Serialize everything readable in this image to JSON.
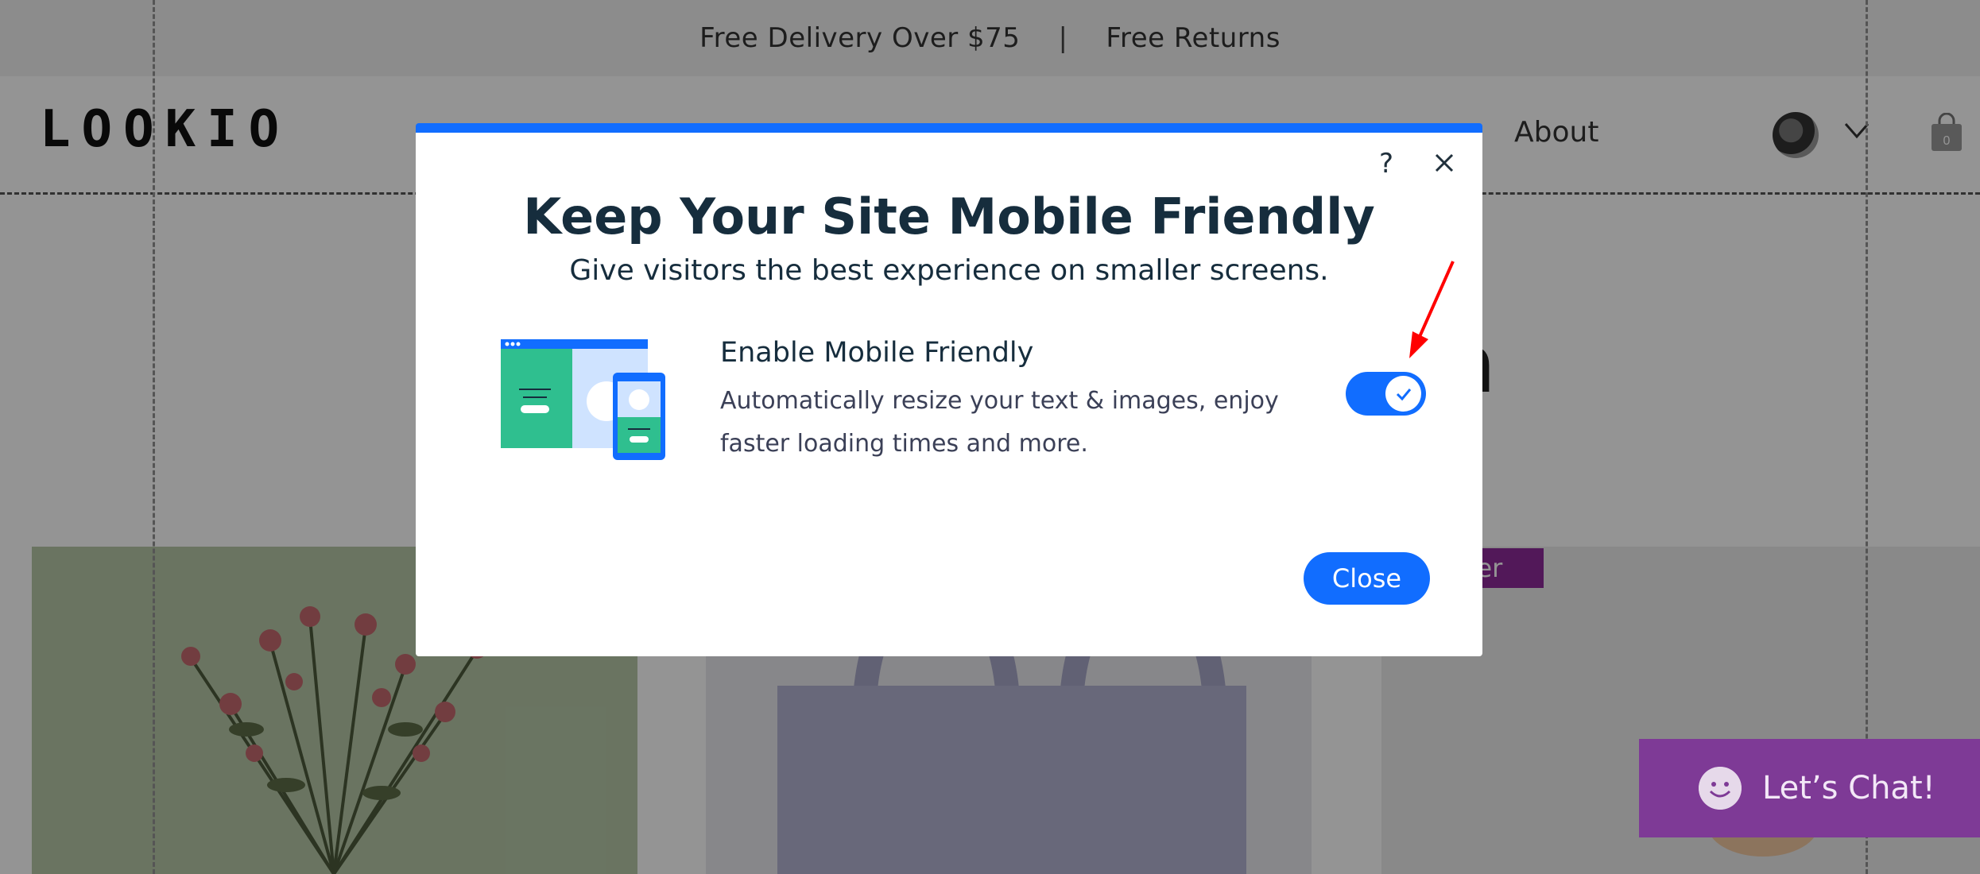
{
  "promo": {
    "delivery": "Free Delivery Over $75",
    "separator": "|",
    "returns": "Free Returns"
  },
  "header": {
    "logo": "LOOKIO",
    "nav_about": "About",
    "cart_count": "0"
  },
  "page": {
    "badge": "eller",
    "chat_label": "Let’s Chat!"
  },
  "modal": {
    "help": "?",
    "title": "Keep Your Site Mobile Friendly",
    "subtitle": "Give visitors the best experience on smaller screens.",
    "feature_title": "Enable Mobile Friendly",
    "feature_desc": "Automatically resize your text & images, enjoy faster loading times and more.",
    "toggle_on": true,
    "close_label": "Close"
  },
  "colors": {
    "accent": "#116dff",
    "title": "#162d3d",
    "chat": "#7e3a96",
    "badge": "#8e2a9a",
    "arrow": "#ff0000"
  },
  "icons": [
    "help-icon",
    "close-icon",
    "check-icon",
    "chevron-down-icon",
    "cart-icon",
    "chat-smile-icon",
    "mobile-friendly-illustration"
  ]
}
